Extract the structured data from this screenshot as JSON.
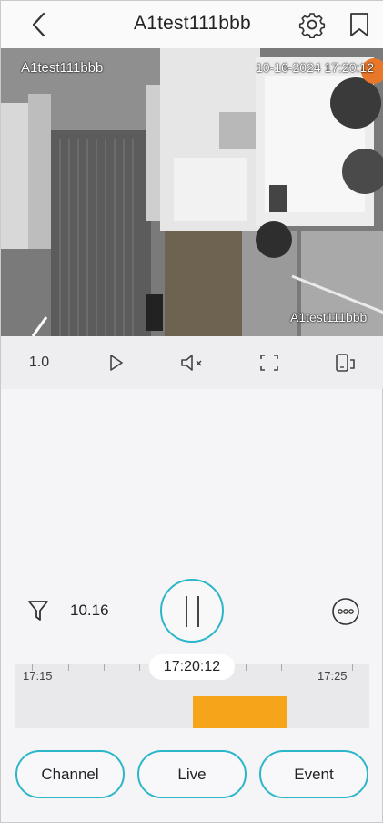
{
  "header": {
    "title": "A1test111bbb",
    "back_icon": "chevron-left-icon",
    "settings_icon": "gear-icon",
    "bookmark_icon": "bookmark-icon"
  },
  "video": {
    "osd_top_left": "A1test111bbb",
    "osd_top_right": "10-16-2024 17:20:12",
    "osd_bottom_right": "A1test111bbb"
  },
  "controls": {
    "speed": "1.0",
    "items": [
      "play-icon",
      "mute-icon",
      "fullscreen-icon",
      "layout-icon"
    ]
  },
  "playback": {
    "date": "10.16",
    "current_time": "17:20:12",
    "timeline_start": "17:15",
    "timeline_end": "17:25",
    "record_color": "#f6a51a",
    "accent_color": "#2cb6c9"
  },
  "buttons": {
    "channel": "Channel",
    "live": "Live",
    "event": "Event"
  }
}
